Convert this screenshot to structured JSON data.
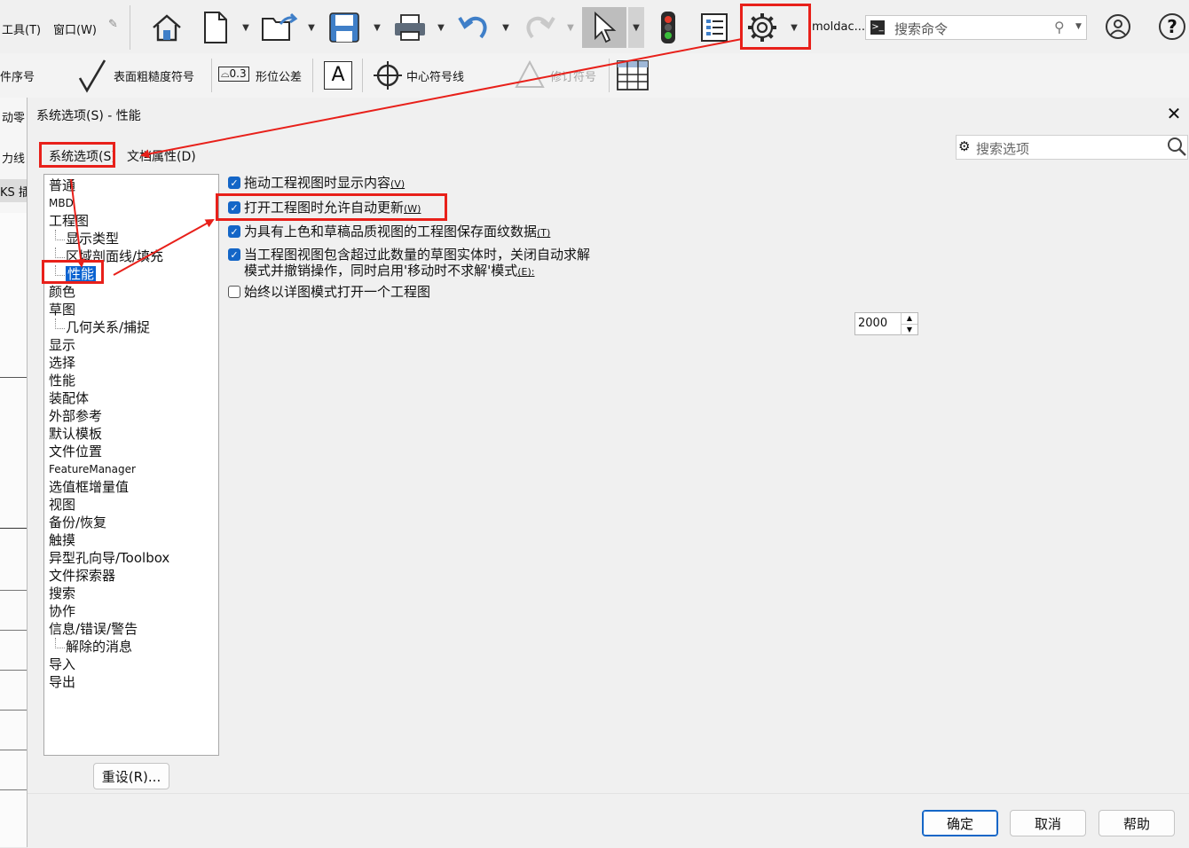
{
  "menu": {
    "tools": "工具(T)",
    "window": "窗口(W)",
    "pin": "📌"
  },
  "toolbar": {
    "user_label": "moldac...",
    "search_cmd_placeholder": "搜索命令",
    "help_label": "?"
  },
  "ribbon": {
    "part_number": "件序号",
    "surface_finish": "表面粗糙度符号",
    "gtol_box": "0.3",
    "gtol": "形位公差",
    "center_mark": "中心符号线",
    "revision": "修订符号"
  },
  "left_sliver": {
    "items": [
      "动零",
      "力线",
      "KS 插"
    ]
  },
  "dialog": {
    "title": "系统选项(S) - 性能",
    "tab_system": "系统选项(S)",
    "tab_document": "文档属性(D)",
    "search_placeholder": "搜索选项",
    "tree": [
      {
        "label": "普通",
        "level": 0
      },
      {
        "label": "MBD",
        "level": 0,
        "small": true
      },
      {
        "label": "工程图",
        "level": 0
      },
      {
        "label": "显示类型",
        "level": 1
      },
      {
        "label": "区域剖面线/填充",
        "level": 1
      },
      {
        "label": "性能",
        "level": 1,
        "selected": true
      },
      {
        "label": "颜色",
        "level": 0
      },
      {
        "label": "草图",
        "level": 0
      },
      {
        "label": "几何关系/捕捉",
        "level": 1
      },
      {
        "label": "显示",
        "level": 0
      },
      {
        "label": "选择",
        "level": 0
      },
      {
        "label": "性能",
        "level": 0
      },
      {
        "label": "装配体",
        "level": 0
      },
      {
        "label": "外部参考",
        "level": 0
      },
      {
        "label": "默认模板",
        "level": 0
      },
      {
        "label": "文件位置",
        "level": 0
      },
      {
        "label": "FeatureManager",
        "level": 0,
        "small": true
      },
      {
        "label": "选值框增量值",
        "level": 0
      },
      {
        "label": "视图",
        "level": 0
      },
      {
        "label": "备份/恢复",
        "level": 0
      },
      {
        "label": "触摸",
        "level": 0
      },
      {
        "label": "异型孔向导/Toolbox",
        "level": 0
      },
      {
        "label": "文件探索器",
        "level": 0
      },
      {
        "label": "搜索",
        "level": 0
      },
      {
        "label": "协作",
        "level": 0
      },
      {
        "label": "信息/错误/警告",
        "level": 0
      },
      {
        "label": "解除的消息",
        "level": 1
      },
      {
        "label": "导入",
        "level": 0
      },
      {
        "label": "导出",
        "level": 0
      }
    ],
    "options": [
      {
        "text": "拖动工程视图时显示内容",
        "mnemonic": "(V)",
        "checked": true
      },
      {
        "text": "打开工程图时允许自动更新",
        "mnemonic": "(W)",
        "checked": true
      },
      {
        "text": "为具有上色和草稿品质视图的工程图保存面纹数据",
        "mnemonic": "(T)",
        "checked": true
      },
      {
        "text": "当工程图视图包含超过此数量的草图实体时，关闭自动求解",
        "text2": "模式并撤销操作，同时启用'移动时不求解'模式",
        "mnemonic": "(E):",
        "checked": true
      },
      {
        "text": "始终以详图模式打开一个工程图",
        "mnemonic": "",
        "checked": false
      }
    ],
    "spin_value": "2000",
    "reset_button": "重设(R)...",
    "ok_button": "确定",
    "cancel_button": "取消",
    "help_button": "帮助"
  },
  "colors": {
    "accent": "#1466c7",
    "annotation_red": "#e8201a"
  }
}
